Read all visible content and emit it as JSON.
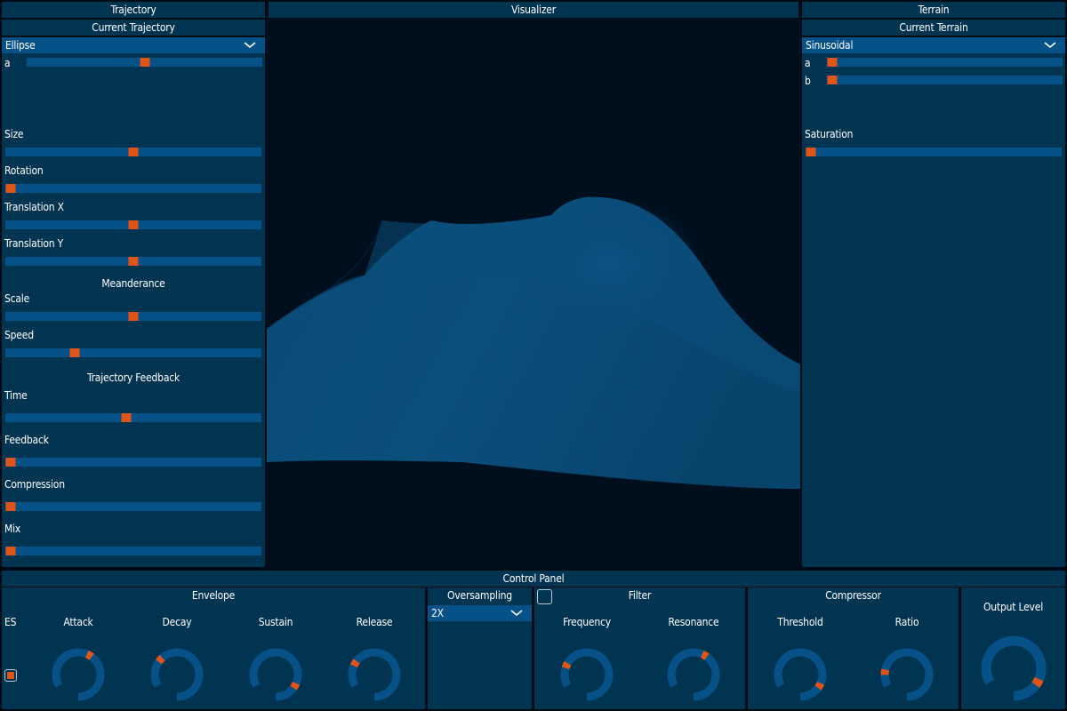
{
  "colors": {
    "background": "#000b14",
    "panel": "#003451",
    "track": "#065188",
    "accent": "#e05417"
  },
  "trajectory": {
    "header": "Trajectory",
    "subheader": "Current Trajectory",
    "dropdown": "Ellipse",
    "param_a": {
      "label": "a",
      "value": 0.5
    },
    "size": {
      "label": "Size",
      "value": 0.5
    },
    "rotation": {
      "label": "Rotation",
      "value": 0.0
    },
    "translation_x": {
      "label": "Translation X",
      "value": 0.5
    },
    "translation_y": {
      "label": "Translation Y",
      "value": 0.5
    },
    "meanderance_header": "Meanderance",
    "scale": {
      "label": "Scale",
      "value": 0.5
    },
    "speed": {
      "label": "Speed",
      "value": 0.26
    },
    "feedback_header": "Trajectory Feedback",
    "time": {
      "label": "Time",
      "value": 0.47
    },
    "feedback": {
      "label": "Feedback",
      "value": 0.0
    },
    "compression": {
      "label": "Compression",
      "value": 0.0
    },
    "mix": {
      "label": "Mix",
      "value": 0.0
    }
  },
  "visualizer": {
    "header": "Visualizer"
  },
  "terrain": {
    "header": "Terrain",
    "subheader": "Current Terrain",
    "dropdown": "Sinusoidal",
    "param_a": {
      "label": "a",
      "value": 0.0
    },
    "param_b": {
      "label": "b",
      "value": 0.0
    },
    "saturation": {
      "label": "Saturation",
      "value": 0.0
    }
  },
  "control_panel": {
    "header": "Control Panel",
    "envelope": {
      "header": "Envelope",
      "es_label": "ES",
      "es_checked": true,
      "attack": {
        "label": "Attack",
        "value": 0.5
      },
      "decay": {
        "label": "Decay",
        "value": 0.24
      },
      "sustain": {
        "label": "Sustain",
        "value": 0.8
      },
      "release": {
        "label": "Release",
        "value": 0.2
      }
    },
    "oversampling": {
      "header": "Oversampling",
      "value": "2X"
    },
    "filter": {
      "header": "Filter",
      "enabled": false,
      "frequency": {
        "label": "Frequency",
        "value": 0.18
      },
      "resonance": {
        "label": "Resonance",
        "value": 0.5
      }
    },
    "compressor": {
      "header": "Compressor",
      "threshold": {
        "label": "Threshold",
        "value": 0.8
      },
      "ratio": {
        "label": "Ratio",
        "value": 0.12
      }
    },
    "output_level": {
      "label": "Output Level",
      "value": 0.8
    }
  }
}
